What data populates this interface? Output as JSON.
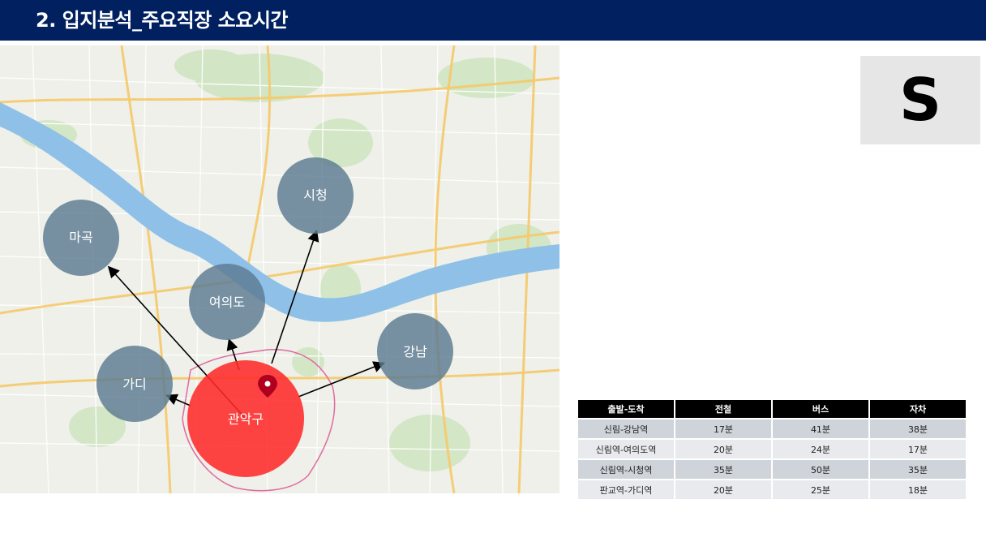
{
  "header": {
    "title": "2. 입지분석_주요직장 소요시간"
  },
  "map": {
    "origin": {
      "label": "관악구",
      "color": "#ff2a2a"
    },
    "destinations": [
      {
        "id": "gangnam",
        "label": "강남"
      },
      {
        "id": "yeouido",
        "label": "여의도"
      },
      {
        "id": "cityhall",
        "label": "시청"
      },
      {
        "id": "mapo",
        "label": "마곡"
      },
      {
        "id": "gasan",
        "label": "가디"
      }
    ],
    "bubble_color": "#5c7a91",
    "river_color": "#7fb4e0"
  },
  "logo": {
    "letter": "S"
  },
  "table": {
    "headers": [
      "출발-도착",
      "전철",
      "버스",
      "자차"
    ],
    "rows": [
      [
        "신림-강남역",
        "17분",
        "41분",
        "38분"
      ],
      [
        "신림역-여의도역",
        "20분",
        "24분",
        "17분"
      ],
      [
        "신림역-시청역",
        "35분",
        "50분",
        "35분"
      ],
      [
        "판교역-가디역",
        "20분",
        "25분",
        "18분"
      ]
    ]
  }
}
